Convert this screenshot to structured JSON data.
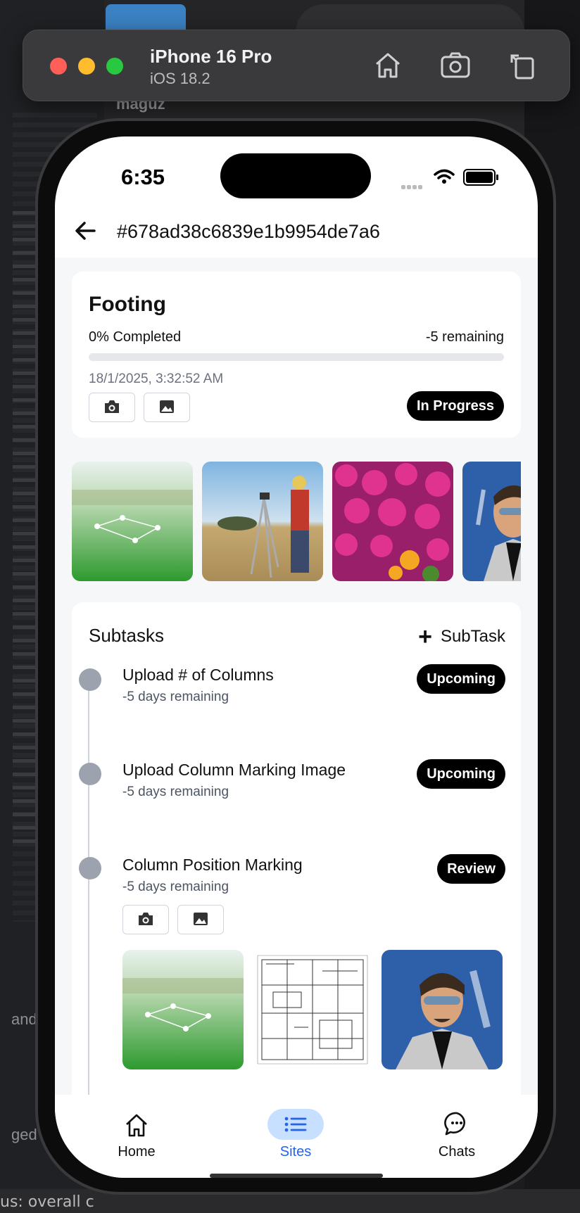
{
  "simulator": {
    "device": "iPhone 16 Pro",
    "os": "iOS 18.2"
  },
  "background": {
    "user_label": "maguz",
    "status_text": "us: overall c",
    "side_text_1": "and",
    "side_text_2": "ged"
  },
  "status_bar": {
    "time": "6:35"
  },
  "header": {
    "title": "#678ad38c6839e1b9954de7a6"
  },
  "task": {
    "title": "Footing",
    "completion": "0% Completed",
    "completion_fraction": 0,
    "remaining": "-5 remaining",
    "date": "18/1/2025, 3:32:52 AM",
    "status": "In Progress"
  },
  "gallery": [
    "field-with-pins-image",
    "surveyor-image",
    "pink-flowers-image",
    "portrait-image"
  ],
  "subtasks": {
    "title": "Subtasks",
    "add_label": "SubTask",
    "items": [
      {
        "name": "Upload # of Columns",
        "remaining": "-5 days remaining",
        "status": "Upcoming"
      },
      {
        "name": "Upload Column Marking Image",
        "remaining": "-5 days remaining",
        "status": "Upcoming"
      },
      {
        "name": "Column Position Marking",
        "remaining": "-5 days remaining",
        "status": "Review"
      }
    ],
    "item3_images": [
      "field-with-pins-image",
      "floor-plan-image",
      "portrait-image"
    ]
  },
  "tabbar": {
    "home": "Home",
    "sites": "Sites",
    "chats": "Chats"
  },
  "colors": {
    "accent": "#2563eb",
    "accent_bg": "#c7e0ff",
    "badge_bg": "#000000",
    "node": "#9ca3af"
  }
}
